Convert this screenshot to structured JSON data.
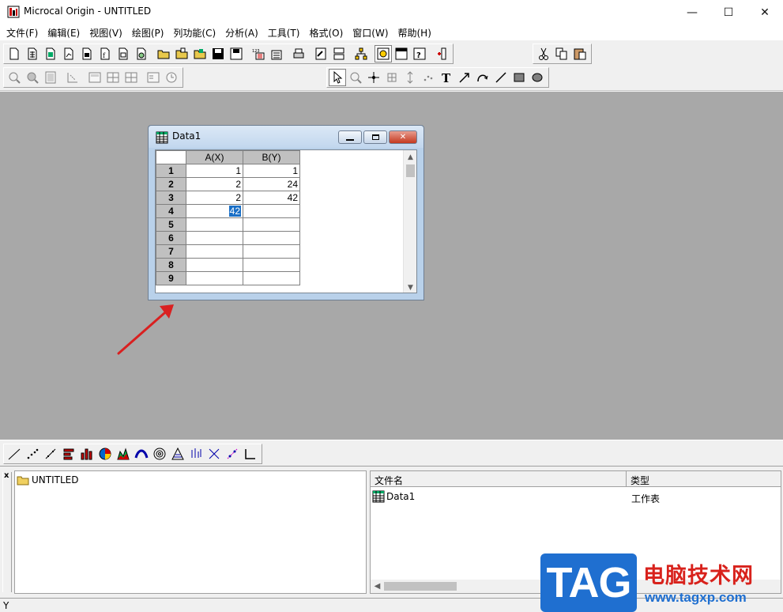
{
  "window": {
    "title": "Microcal Origin - UNTITLED",
    "minimize": "—",
    "maximize": "☐",
    "close": "✕"
  },
  "menu": [
    "文件(F)",
    "编辑(E)",
    "视图(V)",
    "绘图(P)",
    "列功能(C)",
    "分析(A)",
    "工具(T)",
    "格式(O)",
    "窗口(W)",
    "帮助(H)"
  ],
  "worksheet": {
    "title": "Data1",
    "columns": [
      "A(X)",
      "B(Y)"
    ],
    "rows": [
      {
        "n": "1",
        "a": "1",
        "b": "1"
      },
      {
        "n": "2",
        "a": "2",
        "b": "24"
      },
      {
        "n": "3",
        "a": "2",
        "b": "42"
      },
      {
        "n": "4",
        "a": "42",
        "b": ""
      },
      {
        "n": "5",
        "a": "",
        "b": ""
      },
      {
        "n": "6",
        "a": "",
        "b": ""
      },
      {
        "n": "7",
        "a": "",
        "b": ""
      },
      {
        "n": "8",
        "a": "",
        "b": ""
      },
      {
        "n": "9",
        "a": "",
        "b": ""
      }
    ],
    "editing_cell_value": "42"
  },
  "explorer": {
    "close_glyph": "x",
    "folder": "UNTITLED",
    "columns": [
      "文件名",
      "类型"
    ],
    "items": [
      {
        "name": "Data1",
        "type": "工作表"
      }
    ]
  },
  "status": {
    "text": "Y"
  },
  "watermark": {
    "tag": "TAG",
    "site_cn": "电脑技术网",
    "url": "www.tagxp.com"
  },
  "colors": {
    "workspace": "#a8a8a8",
    "header_gray": "#c0c0c0",
    "selection": "#1a6fc6",
    "arrow": "#d92020"
  }
}
